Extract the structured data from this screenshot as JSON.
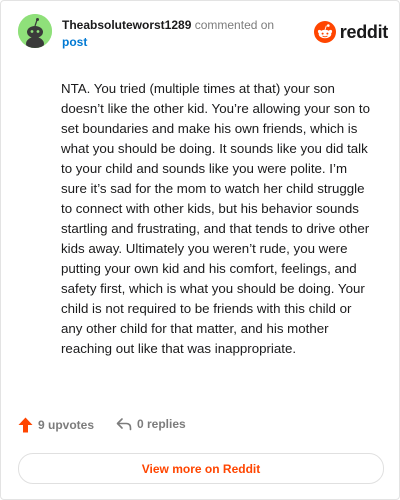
{
  "comment": {
    "username": "Theabsoluteworst1289",
    "action": "commented on",
    "post_label": "post",
    "body": "NTA. You tried (multiple times at that) your son doesn’t like the other kid. You’re allowing your son to set boundaries and make his own friends, which is what you should be doing. It sounds like you did talk to your child and sounds like you were polite. I’m sure it’s sad for the mom to watch her child struggle to connect with other kids, but his behavior sounds startling and frustrating, and that tends to drive other kids away. Ultimately you weren’t rude, you were putting your own kid and his comfort, feelings, and safety first, which is what you should be doing. Your child is not required to be friends with this child or any other child for that matter, and his mother reaching out like that was inappropriate."
  },
  "brand": {
    "name": "reddit",
    "color": "#ff4500"
  },
  "stats": {
    "upvotes": "9 upvotes",
    "replies": "0 replies"
  },
  "cta": {
    "label": "View more on Reddit"
  },
  "icons": {
    "avatar": "snoo-avatar-icon",
    "logo": "reddit-logo-icon",
    "upvote": "upvote-arrow-icon",
    "reply": "reply-arrow-icon"
  },
  "colors": {
    "avatar_bg": "#8fe07a",
    "link": "#0079d3",
    "muted": "#7c7c7c"
  }
}
